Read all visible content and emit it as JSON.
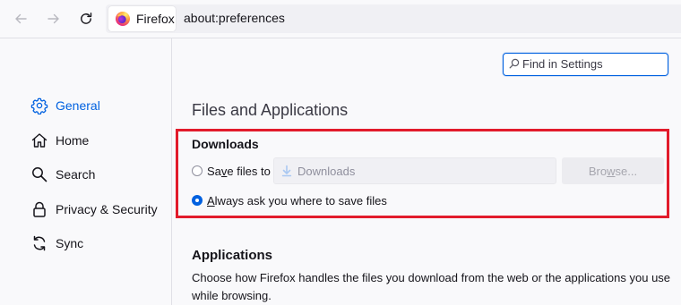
{
  "toolbar": {
    "back_icon": "back-arrow-icon",
    "forward_icon": "forward-arrow-icon",
    "reload_icon": "reload-icon",
    "identity_label": "Firefox",
    "url": "about:preferences"
  },
  "sidebar": {
    "items": [
      {
        "label": "General",
        "icon": "gear-icon",
        "selected": true
      },
      {
        "label": "Home",
        "icon": "home-icon",
        "selected": false
      },
      {
        "label": "Search",
        "icon": "search-icon",
        "selected": false
      },
      {
        "label": "Privacy & Security",
        "icon": "lock-icon",
        "selected": false
      },
      {
        "label": "Sync",
        "icon": "sync-icon",
        "selected": false
      }
    ]
  },
  "search": {
    "placeholder": "Find in Settings",
    "value": ""
  },
  "main": {
    "section_title": "Files and Applications",
    "downloads": {
      "title": "Downloads",
      "save_files_to": {
        "pre": "Sa",
        "accesskey": "v",
        "post": "e files to",
        "checked": false
      },
      "always_ask": {
        "pre": "",
        "accesskey": "A",
        "post": "lways ask you where to save files",
        "checked": true
      },
      "folder": "Downloads",
      "browse": {
        "pre": "Bro",
        "accesskey": "w",
        "post": "se..."
      }
    },
    "applications": {
      "title": "Applications",
      "description": "Choose how Firefox handles the files you download from the web or the applications you use while browsing."
    }
  },
  "colors": {
    "accent": "#0061e0",
    "highlight_border": "#e21b2b",
    "background": "#f9f9fb"
  }
}
